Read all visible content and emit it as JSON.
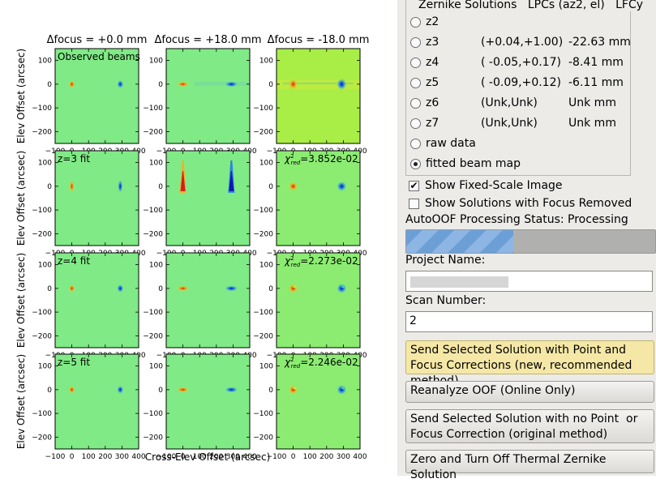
{
  "figure": {
    "column_titles": [
      "Δfocus = +0.0 mm",
      "Δfocus = +18.0 mm",
      "Δfocus = -18.0 mm"
    ],
    "row_labels": [
      "Observed beams",
      "z=3 fit",
      "z=4 fit",
      "z=5 fit"
    ],
    "chi_labels": [
      "",
      "=3.852e-02",
      "=2.273e-02",
      "=2.246e-02"
    ],
    "y_axis_label": "Elev Offset (arcsec)",
    "x_axis_label": "Cross-Elev Offset (arcsec)",
    "x_ticks": [
      "−100",
      "0",
      "100",
      "200",
      "300",
      "400"
    ],
    "y_ticks": [
      "100",
      "0",
      "−100",
      "−200"
    ]
  },
  "chart_data": {
    "type": "heatmap",
    "x_range": [
      -100,
      400
    ],
    "y_range": [
      -250,
      150
    ],
    "xlabel": "Cross-Elev Offset (arcsec)",
    "ylabel": "Elev Offset (arcsec)",
    "panels_per_row": 3,
    "rows": 4,
    "beam_centers_x": [
      0,
      290
    ],
    "beam_center_y": 0
  },
  "panel": {
    "frame_title": "Zernike Solutions   LPCs (az2, el)   LFCy",
    "radios": [
      {
        "label": "z2",
        "lpc": "",
        "value": ""
      },
      {
        "label": "z3",
        "lpc": "(+0.04,+1.00)",
        "value": "-22.63 mm"
      },
      {
        "label": "z4",
        "lpc": "( -0.05,+0.17)",
        "value": "-8.41 mm"
      },
      {
        "label": "z5",
        "lpc": "( -0.09,+0.12)",
        "value": "-6.11 mm"
      },
      {
        "label": "z6",
        "lpc": "(Unk,Unk)",
        "value": "Unk mm"
      },
      {
        "label": "z7",
        "lpc": "(Unk,Unk)",
        "value": "Unk mm"
      },
      {
        "label": "raw data",
        "lpc": "",
        "value": ""
      },
      {
        "label": "fitted beam map",
        "lpc": "",
        "value": ""
      }
    ],
    "selected_radio": "fitted beam map",
    "check_fixed_scale": "Show Fixed-Scale Image",
    "check_focus_removed": "Show Solutions with Focus Removed",
    "status": "AutoOOF Processing Status: Processing",
    "progress_fraction": 0.43,
    "project_label": "Project Name:",
    "scan_label": "Scan Number:",
    "scan_value": "2",
    "btn_send_point": "Send Selected Solution with Point and Focus Corrections (new, recommended method)",
    "btn_reanalyze": "Reanalyze OOF (Online Only)",
    "btn_send_no_point": "Send Selected Solution with no Point  or Focus Correction (original method)",
    "btn_zero": "Zero and Turn Off Thermal Zernike Solution"
  }
}
